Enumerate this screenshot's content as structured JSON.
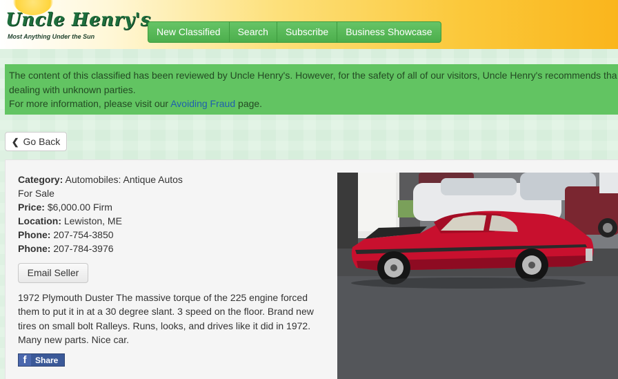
{
  "header": {
    "logo_text": "Uncle Henry's",
    "tagline": "Most Anything Under the Sun",
    "nav": [
      "New Classified",
      "Search",
      "Subscribe",
      "Business Showcase"
    ]
  },
  "notice": {
    "line1": "The content of this classified has been reviewed by Uncle Henry's. However, for the safety of all of our visitors, Uncle Henry's recommends tha",
    "line2": "dealing with unknown parties.",
    "line3_prefix": "For more information, please visit our ",
    "link": "Avoiding Fraud",
    "line3_suffix": " page."
  },
  "back_label": "Go Back",
  "listing": {
    "category_label": "Category:",
    "category": "Automobiles: Antique Autos",
    "sale_type": "For Sale",
    "price_label": "Price:",
    "price": "$6,000.00 Firm",
    "location_label": "Location:",
    "location": "Lewiston, ME",
    "phone_label": "Phone:",
    "phone1": "207-754-3850",
    "phone2": "207-784-3976",
    "email_button": "Email Seller",
    "description": "1972 Plymouth Duster The massive torque of the 225 engine forced them to put it in at a 30 degree slant. 3 speed on the floor. Brand new tires on small bolt Ralleys. Runs, looks, and drives like it did in 1972. Many new parts. Nice car.",
    "share_label": "Share"
  },
  "colors": {
    "nav_green": "#5cb85c",
    "notice_green": "#62c462",
    "link_blue": "#1f5fae",
    "facebook_blue": "#3b5998",
    "car_red": "#c8102e"
  }
}
